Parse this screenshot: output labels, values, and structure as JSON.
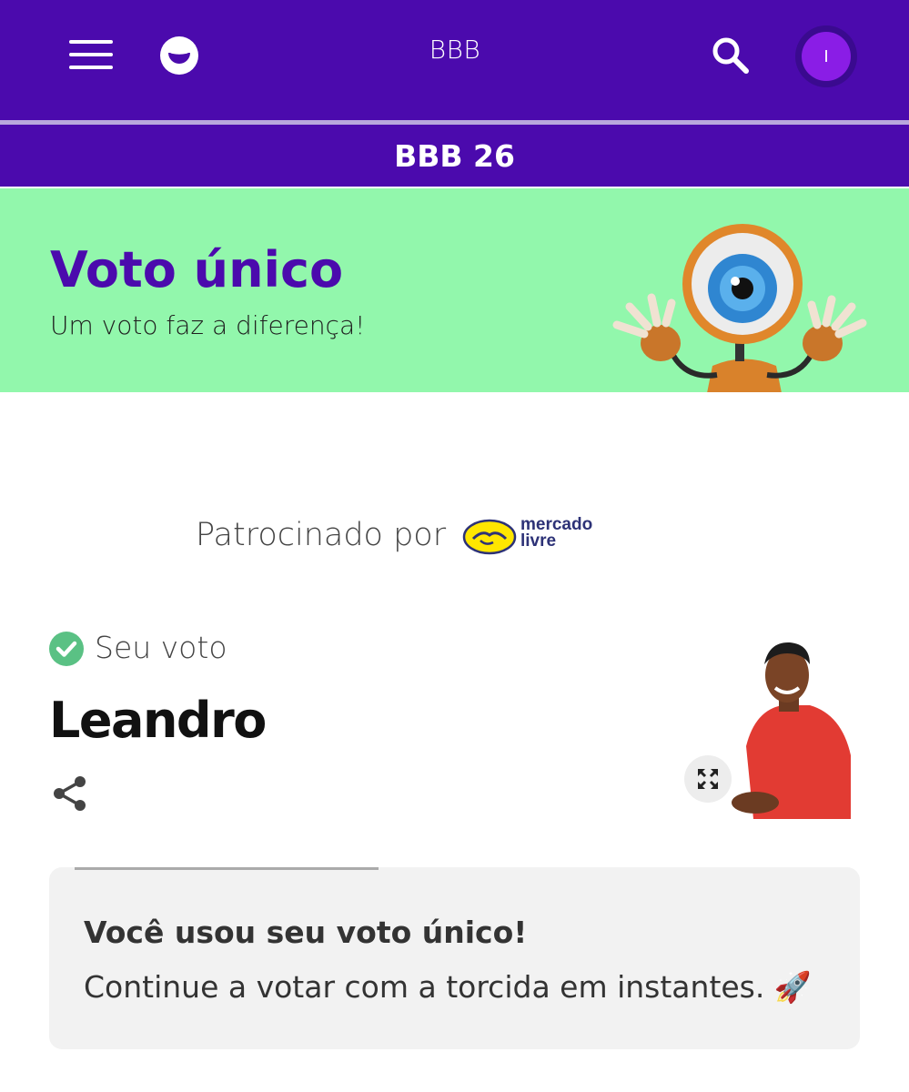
{
  "header": {
    "title": "BBB",
    "avatar_initial": "I",
    "icons": [
      "menu-icon",
      "globo-logo-icon",
      "search-icon"
    ]
  },
  "subheader": {
    "label": "BBB 26"
  },
  "banner": {
    "title": "Voto único",
    "subtitle": "Um voto faz a diferença!",
    "colors": {
      "background": "#92f7ac",
      "title": "#4b0aad"
    }
  },
  "sponsor": {
    "label": "Patrocinado por",
    "brand_line1": "mercado",
    "brand_line2": "livre"
  },
  "vote": {
    "status_label": "Seu voto",
    "candidate": "Leandro"
  },
  "info_card": {
    "title": "Você usou seu voto único!",
    "message": "Continue a votar com a torcida em instantes. 🚀",
    "progress": 0.4
  },
  "colors": {
    "brand_purple": "#4b0aad",
    "check_green": "#5ac184",
    "card_bg": "#f2f2f2"
  }
}
